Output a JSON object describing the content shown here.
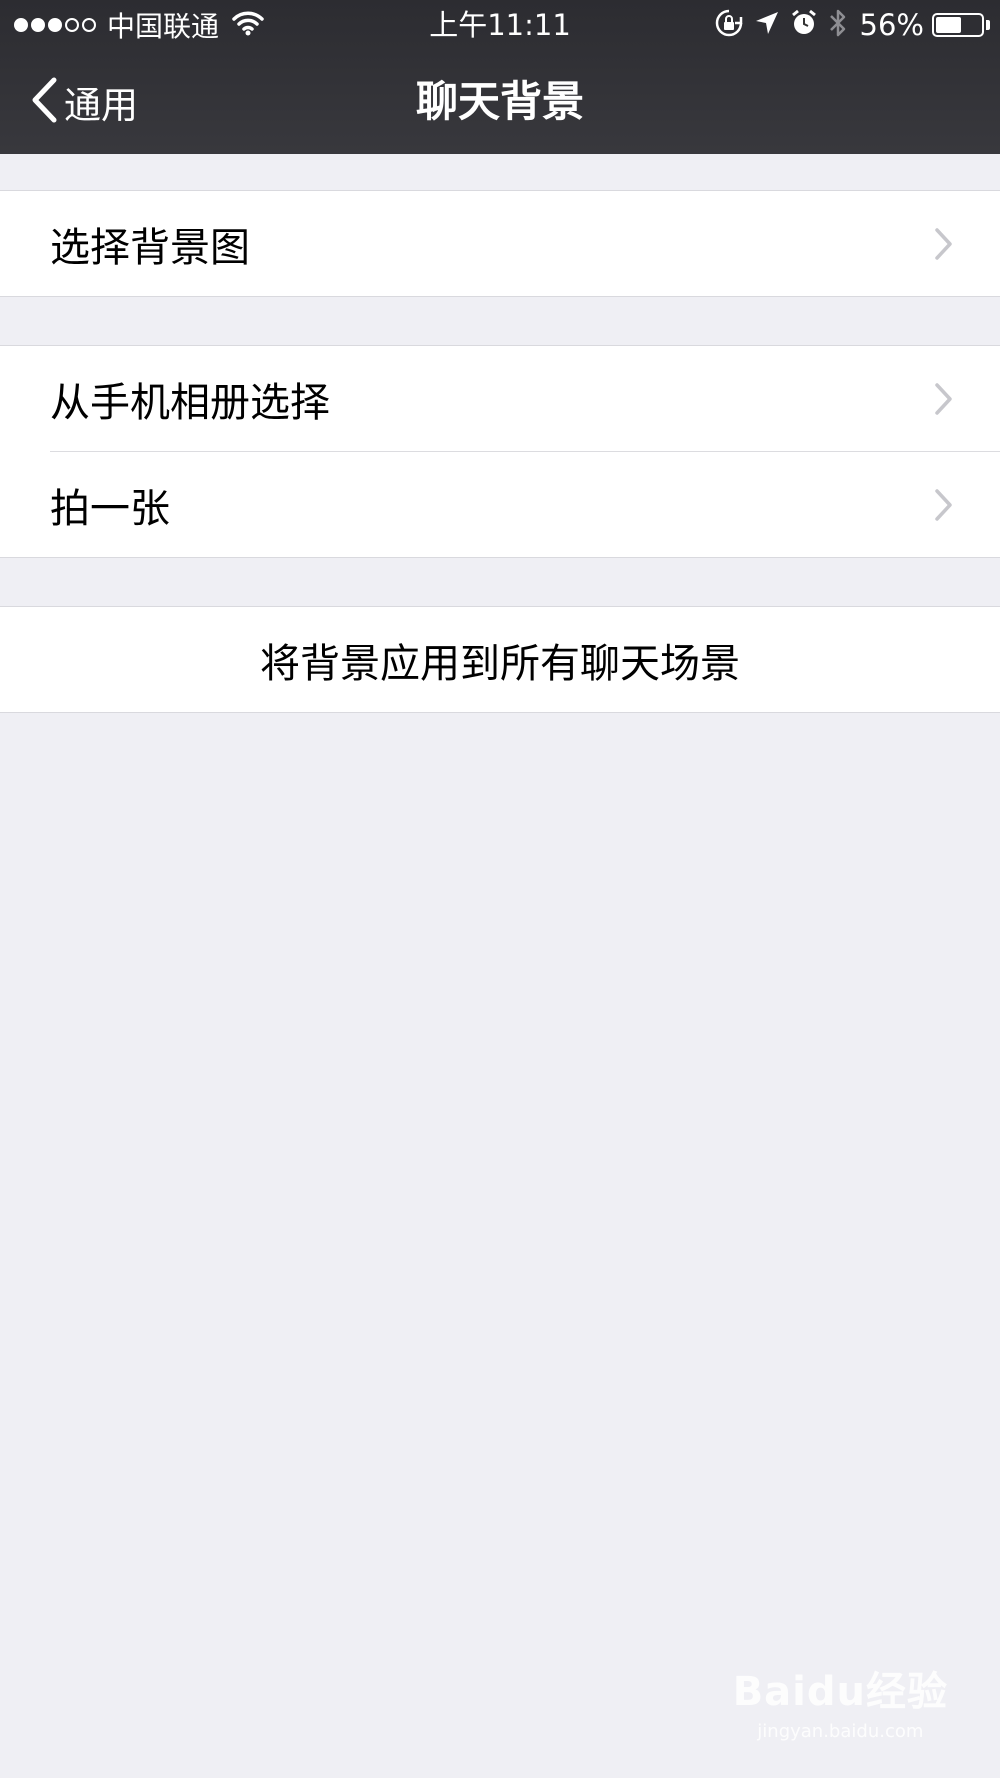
{
  "status_bar": {
    "carrier": "中国联通",
    "time": "上午11:11",
    "battery_percent": "56%",
    "battery_level": 0.56,
    "signal_bars_filled": 3,
    "signal_bars_total": 5,
    "icons": [
      "wifi-icon",
      "rotation-lock-icon",
      "location-arrow-icon",
      "alarm-clock-icon",
      "bluetooth-icon",
      "battery-icon"
    ]
  },
  "nav": {
    "back_label": "通用",
    "title": "聊天背景"
  },
  "sections": [
    {
      "items": [
        {
          "label": "选择背景图"
        }
      ]
    },
    {
      "items": [
        {
          "label": "从手机相册选择"
        },
        {
          "label": "拍一张"
        }
      ]
    },
    {
      "items": [
        {
          "label": "将背景应用到所有聊天场景"
        }
      ]
    }
  ],
  "watermark": {
    "brand": "Baidu经验",
    "url": "jingyan.baidu.com"
  },
  "colors": {
    "nav_bg": "#333338",
    "page_bg": "#efeff4",
    "cell_bg": "#ffffff",
    "chevron": "#c7c7cc"
  }
}
